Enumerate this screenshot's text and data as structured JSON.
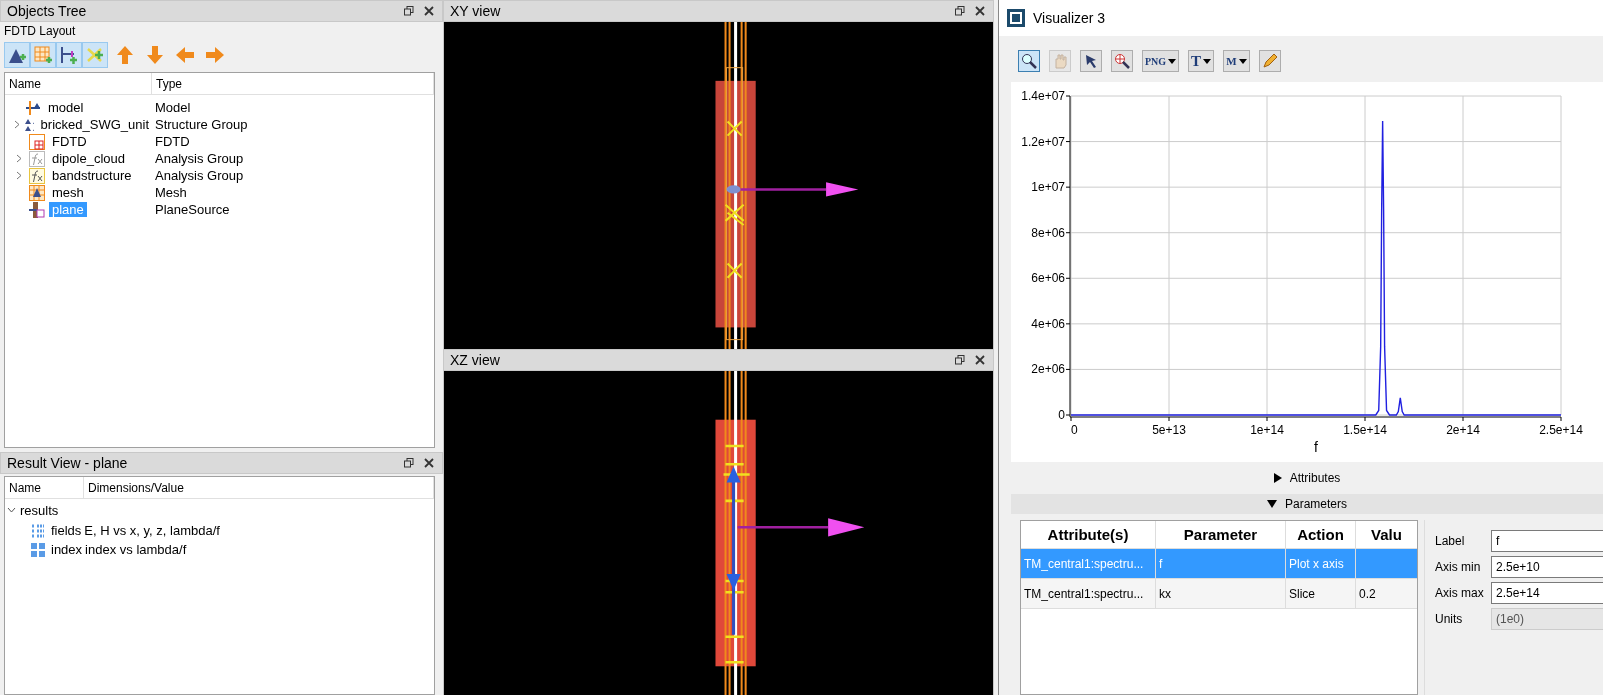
{
  "objects_tree": {
    "title": "Objects Tree",
    "subtitle": "FDTD Layout",
    "tools": [
      {
        "kind": "structure",
        "selected": true
      },
      {
        "kind": "grid",
        "selected": true
      },
      {
        "kind": "ruler",
        "selected": true
      },
      {
        "kind": "cross",
        "selected": true
      },
      {
        "kind": "up",
        "selected": false
      },
      {
        "kind": "down",
        "selected": false
      },
      {
        "kind": "left",
        "selected": false
      },
      {
        "kind": "right",
        "selected": false
      }
    ],
    "columns": [
      "Name",
      "Type"
    ],
    "root": {
      "name": "model",
      "type": "Model",
      "kind": "model",
      "selected": false,
      "collapsed": false,
      "children": [
        {
          "name": "bricked_SWG_unit",
          "type": "Structure Group",
          "kind": "structure_group",
          "selected": false,
          "collapsed": true
        },
        {
          "name": "FDTD",
          "type": "FDTD",
          "kind": "fdtd",
          "selected": false,
          "collapsed": false
        },
        {
          "name": "dipole_cloud",
          "type": "Analysis Group",
          "kind": "analysis_grey",
          "selected": false,
          "collapsed": true
        },
        {
          "name": "bandstructure",
          "type": "Analysis Group",
          "kind": "analysis",
          "selected": false,
          "collapsed": true
        },
        {
          "name": "mesh",
          "type": "Mesh",
          "kind": "mesh",
          "selected": false,
          "collapsed": false
        },
        {
          "name": "plane",
          "type": "PlaneSource",
          "kind": "source",
          "selected": true,
          "collapsed": false
        }
      ]
    }
  },
  "result_view": {
    "title": "Result View - plane",
    "columns": [
      "Name",
      "Dimensions/Value"
    ],
    "root": {
      "name": "results",
      "expanded": true,
      "children": [
        {
          "name": "fields",
          "value": "E, H vs x, y, z, lambda/f",
          "kind": "matrix"
        },
        {
          "name": "index",
          "value": "index vs lambda/f",
          "kind": "grid"
        }
      ]
    }
  },
  "xy_view": {
    "title": "XY view"
  },
  "xz_view": {
    "title": "XZ view"
  },
  "visualizer": {
    "title": "Visualizer 3",
    "tools": [
      {
        "kind": "zoom",
        "selected": true,
        "disabled": false
      },
      {
        "kind": "pan",
        "selected": false,
        "disabled": true
      },
      {
        "kind": "pointer",
        "selected": false,
        "disabled": false
      },
      {
        "kind": "zoom_region",
        "selected": false,
        "disabled": false
      },
      {
        "kind": "export",
        "glyph": "PNG",
        "selected": false,
        "disabled": false
      },
      {
        "kind": "text",
        "glyph": "T",
        "selected": false,
        "disabled": false
      },
      {
        "kind": "marker",
        "glyph": "M",
        "selected": false,
        "disabled": false
      },
      {
        "kind": "pencil",
        "selected": false,
        "disabled": false
      }
    ],
    "chart_data": {
      "type": "line",
      "xlabel": "f",
      "grid": true,
      "x": [
        0,
        150000000000000.0,
        155500000000000.0,
        157000000000000.0,
        158000000000000.0,
        158500000000000.0,
        159000000000000.0,
        159500000000000.0,
        160000000000000.0,
        161000000000000.0,
        162500000000000.0,
        166000000000000.0,
        167000000000000.0,
        168000000000000.0,
        169000000000000.0,
        170000000000000.0,
        250000000000000.0
      ],
      "series": [
        {
          "color": "#2020e0",
          "values": [
            0,
            0,
            0,
            200000,
            3000000,
            9000000,
            12900000,
            9000000,
            3000000,
            200000,
            0,
            0,
            150000,
            750000,
            150000,
            0,
            0
          ]
        }
      ],
      "xlim": [
        0,
        250000000000000.0
      ],
      "ylim": [
        0,
        14000000
      ],
      "xticks": [
        {
          "value": 0,
          "label": "0"
        },
        {
          "value": 50000000000000.0,
          "label": "5e+13"
        },
        {
          "value": 100000000000000.0,
          "label": "1e+14"
        },
        {
          "value": 150000000000000.0,
          "label": "1.5e+14"
        },
        {
          "value": 200000000000000.0,
          "label": "2e+14"
        },
        {
          "value": 250000000000000.0,
          "label": "2.5e+14"
        }
      ],
      "yticks": [
        {
          "value": 0,
          "label": "0"
        },
        {
          "value": 2000000,
          "label": "2e+06"
        },
        {
          "value": 4000000,
          "label": "4e+06"
        },
        {
          "value": 6000000,
          "label": "6e+06"
        },
        {
          "value": 8000000,
          "label": "8e+06"
        },
        {
          "value": 10000000,
          "label": "1e+07"
        },
        {
          "value": 12000000,
          "label": "1.2e+07"
        },
        {
          "value": 14000000,
          "label": "1.4e+07"
        }
      ]
    },
    "sections": [
      {
        "label": "Attributes",
        "expanded": false
      },
      {
        "label": "Parameters",
        "expanded": true
      }
    ],
    "parameters": {
      "columns": [
        "Attribute(s)",
        "Parameter",
        "Action",
        "Valu"
      ],
      "rows": [
        {
          "attribute": "TM_central1:spectru...",
          "parameter": "f",
          "action": "Plot x axis",
          "selected": true
        },
        {
          "attribute": "TM_central1:spectru...",
          "parameter": "kx",
          "action": "Slice",
          "value": "0.2",
          "selected": false
        }
      ]
    },
    "axis_form": [
      {
        "label": "Label",
        "value": "f",
        "disabled": false
      },
      {
        "label": "Axis min",
        "value": "2.5e+10",
        "disabled": false
      },
      {
        "label": "Axis max",
        "value": "2.5e+14",
        "disabled": false
      },
      {
        "label": "Units",
        "value": "(1e0)",
        "disabled": true
      }
    ]
  }
}
